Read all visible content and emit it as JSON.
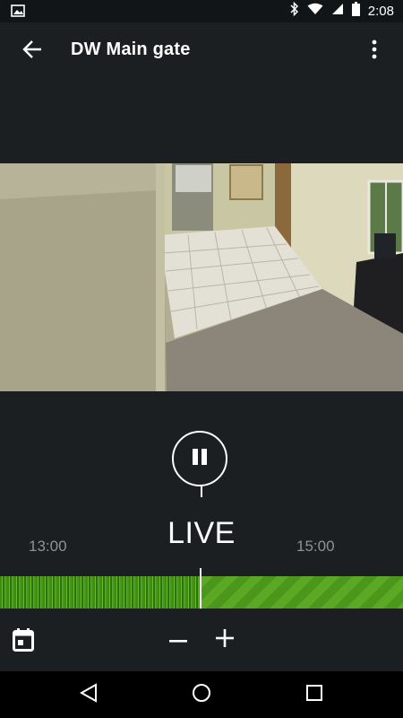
{
  "status_bar": {
    "time": "2:08",
    "icons": [
      "gallery-icon",
      "bluetooth-icon",
      "wifi-icon",
      "cell-signal-icon",
      "battery-icon"
    ]
  },
  "app_bar": {
    "title": "DW Main gate",
    "back_icon": "arrow-left-icon",
    "more_icon": "more-vertical-icon"
  },
  "player": {
    "state_label": "LIVE",
    "control_icon": "pause-icon"
  },
  "timeline": {
    "tick_left": "13:00",
    "tick_right": "15:00"
  },
  "toolbar": {
    "calendar_icon": "calendar-icon",
    "zoom_out_label": "−",
    "zoom_in_label": "+"
  },
  "nav_bar": {
    "icons": [
      "nav-back-icon",
      "nav-home-icon",
      "nav-recents-icon"
    ]
  },
  "colors": {
    "background": "#1b1f22",
    "status_bar": "#121517",
    "timeline_green": "#5aa823",
    "text_muted": "#8e9295"
  }
}
